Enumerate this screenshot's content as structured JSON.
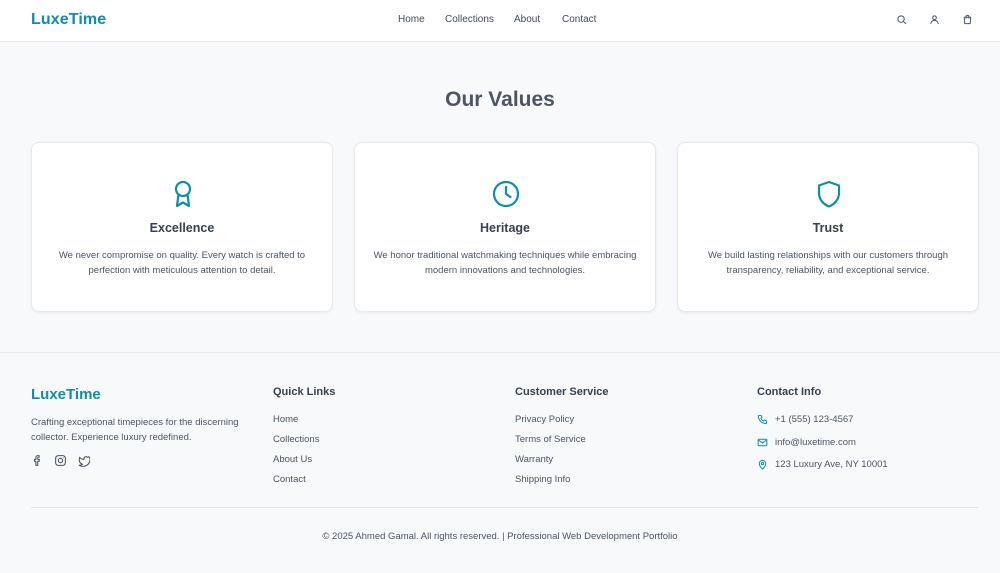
{
  "brand": {
    "name": "LuxeTime",
    "accent_color": "#0e8ea8"
  },
  "nav": {
    "items": [
      "Home",
      "Collections",
      "About",
      "Contact"
    ]
  },
  "header_icons": [
    "search-icon",
    "user-icon",
    "shopping-bag-icon"
  ],
  "values_section": {
    "title": "Our Values",
    "cards": [
      {
        "icon": "award-icon",
        "title": "Excellence",
        "text": "We never compromise on quality. Every watch is crafted to perfection with meticulous attention to detail."
      },
      {
        "icon": "clock-icon",
        "title": "Heritage",
        "text": "We honor traditional watchmaking techniques while embracing modern innovations and technologies."
      },
      {
        "icon": "shield-icon",
        "title": "Trust",
        "text": "We build lasting relationships with our customers through transparency, reliability, and exceptional service."
      }
    ]
  },
  "footer": {
    "brand": "LuxeTime",
    "description": "Crafting exceptional timepieces for the discerning collector. Experience luxury redefined.",
    "social_icons": [
      "facebook-icon",
      "instagram-icon",
      "twitter-icon"
    ],
    "quick_links": {
      "title": "Quick Links",
      "items": [
        "Home",
        "Collections",
        "About Us",
        "Contact"
      ]
    },
    "customer_service": {
      "title": "Customer Service",
      "items": [
        "Privacy Policy",
        "Terms of Service",
        "Warranty",
        "Shipping Info"
      ]
    },
    "contact": {
      "title": "Contact Info",
      "items": [
        {
          "icon": "phone-icon",
          "text": "+1 (555) 123-4567"
        },
        {
          "icon": "mail-icon",
          "text": "info@luxetime.com"
        },
        {
          "icon": "map-pin-icon",
          "text": "123 Luxury Ave, NY 10001"
        }
      ]
    },
    "copyright": "© 2025 Ahmed Gamal. All rights reserved. | Professional Web Development Portfolio"
  }
}
